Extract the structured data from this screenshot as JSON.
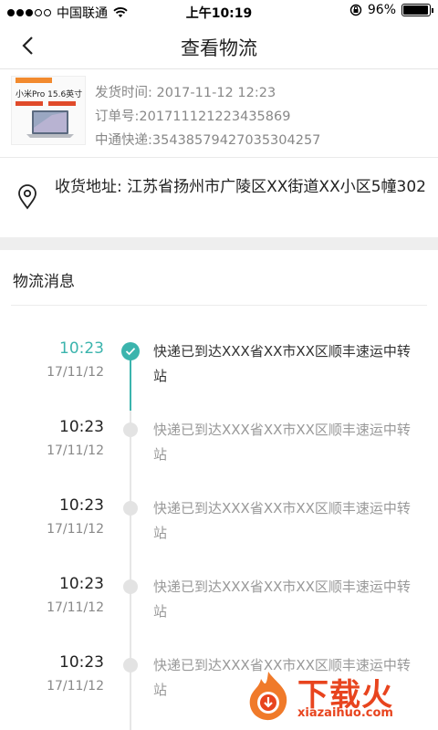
{
  "status_bar": {
    "carrier": "中国联通",
    "time": "上午10:19",
    "battery_percent": "96%",
    "battery_level": 0.96
  },
  "nav": {
    "title": "查看物流"
  },
  "order": {
    "product_image_text": "小米Pro 15.6英寸",
    "rows": [
      {
        "label": "发货时间:",
        "value": "2017-11-12 12:23"
      },
      {
        "label": "订单号:",
        "value": "201711121223435869"
      },
      {
        "label": "中通快递:",
        "value": "35438579427035304257"
      }
    ]
  },
  "address": {
    "label": "收货地址:",
    "value": "江苏省扬州市广陵区XX街道XX小区5幢302"
  },
  "logistics": {
    "section_title": "物流消息",
    "items": [
      {
        "time": "10:23",
        "date": "17/11/12",
        "desc": "快递已到达XXX省XX市XX区顺丰速运中转站",
        "active": true
      },
      {
        "time": "10:23",
        "date": "17/11/12",
        "desc": "快递已到达XXX省XX市XX区顺丰速运中转站",
        "active": false
      },
      {
        "time": "10:23",
        "date": "17/11/12",
        "desc": "快递已到达XXX省XX市XX区顺丰速运中转站",
        "active": false
      },
      {
        "time": "10:23",
        "date": "17/11/12",
        "desc": "快递已到达XXX省XX市XX区顺丰速运中转站",
        "active": false
      },
      {
        "time": "10:23",
        "date": "17/11/12",
        "desc": "快递已到达XXX省XX市XX区顺丰速运中转站",
        "active": false
      }
    ]
  },
  "watermark": {
    "text": "下载火",
    "sub": "xiazaihuo.com"
  },
  "colors": {
    "accent": "#3bb4ad",
    "muted": "#999999",
    "watermark": "#e8441e"
  }
}
